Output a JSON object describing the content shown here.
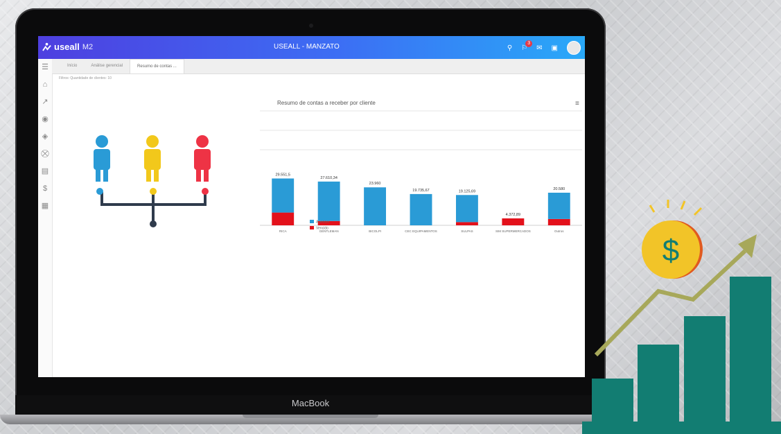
{
  "device": {
    "brand_label": "MacBook"
  },
  "app": {
    "logo_text": "useall",
    "logo_sub": "M2",
    "title": "USEALL - MANZATO",
    "notification_count": "3"
  },
  "tabs": [
    {
      "label": "Início"
    },
    {
      "label": "Análise gerencial"
    },
    {
      "label": "Resumo de contas ..."
    }
  ],
  "filter_text": "Filtros: Quantidade de clientes: 10",
  "sidebar_icons": [
    "home-icon",
    "chart-line-icon",
    "basket-icon",
    "boxes-icon",
    "cart-icon",
    "card-icon",
    "dollar-icon",
    "calculator-icon"
  ],
  "people_colors": [
    "#2a9bd6",
    "#f2c81b",
    "#ee3345"
  ],
  "chart_data": {
    "type": "bar",
    "title": "Resumo de contas a receber por cliente",
    "categories": [
      "RICA",
      "GENTLEMAN",
      "BICOLPI",
      "CEC EQUIPAMENTOS",
      "SULPAS",
      "SIM SUPERMERCADOS",
      "Outros"
    ],
    "data_labels": [
      "29.551,5",
      "27.610,34",
      "23.960",
      "19.735,67",
      "19.125,69",
      "4.372,89",
      "20.580"
    ],
    "series": [
      {
        "name": "A vencer",
        "values": [
          21500,
          24900,
          23960,
          19736,
          17100,
          0,
          16600
        ],
        "color": "#2a9bd6"
      },
      {
        "name": "Vencido",
        "values": [
          8051,
          2710,
          0,
          0,
          2026,
          4373,
          3980
        ],
        "color": "#e3111b"
      }
    ],
    "legend_position": "bottom-left",
    "grid": true
  },
  "decoration": {
    "coin_symbol": "$",
    "coin_color": "#f2c428",
    "arrow_color": "#a7a85a",
    "bars_color": "#127d72"
  }
}
